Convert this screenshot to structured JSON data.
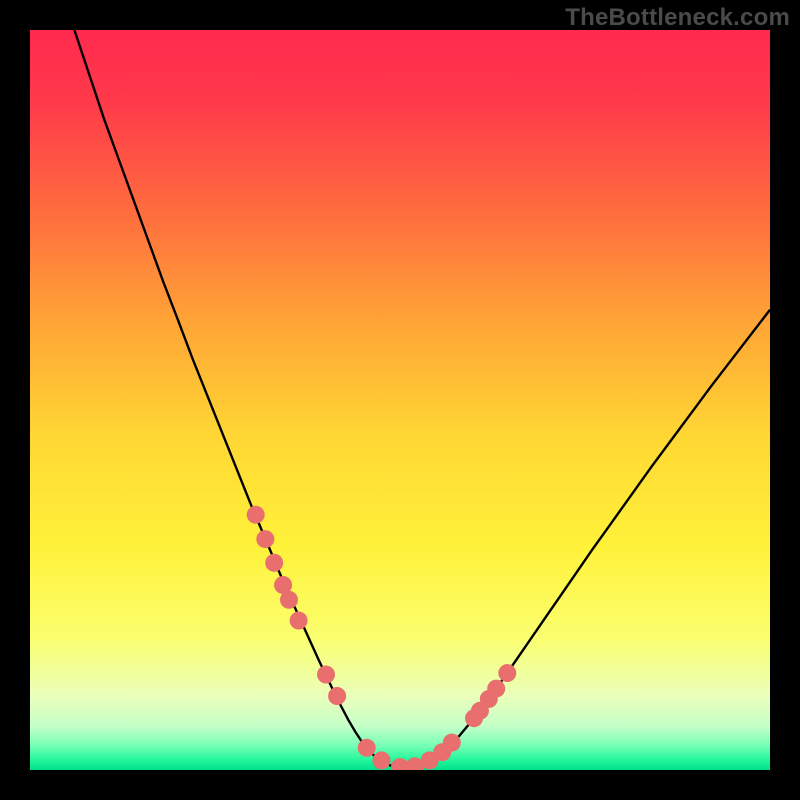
{
  "watermark": "TheBottleneck.com",
  "colors": {
    "background": "#000000",
    "curve": "#000000",
    "marker_fill": "#e96f6f",
    "marker_stroke": "#c95858",
    "gradient_stops": [
      {
        "offset": 0.0,
        "color": "#ff2a4e"
      },
      {
        "offset": 0.1,
        "color": "#ff3a4a"
      },
      {
        "offset": 0.25,
        "color": "#ff6e3e"
      },
      {
        "offset": 0.4,
        "color": "#ffa636"
      },
      {
        "offset": 0.55,
        "color": "#ffd733"
      },
      {
        "offset": 0.7,
        "color": "#fff23a"
      },
      {
        "offset": 0.82,
        "color": "#fbff6e"
      },
      {
        "offset": 0.9,
        "color": "#eaffba"
      },
      {
        "offset": 0.94,
        "color": "#c6ffc8"
      },
      {
        "offset": 0.965,
        "color": "#7dffb8"
      },
      {
        "offset": 0.985,
        "color": "#29f89d"
      },
      {
        "offset": 1.0,
        "color": "#00e08c"
      }
    ]
  },
  "chart_data": {
    "type": "line",
    "title": "",
    "xlabel": "",
    "ylabel": "",
    "xlim": [
      0,
      100
    ],
    "ylim": [
      0,
      100
    ],
    "grid": false,
    "legend": false,
    "series": [
      {
        "name": "bottleneck-curve",
        "x": [
          6,
          8,
          10,
          12,
          14,
          16,
          18,
          20,
          22,
          24,
          26,
          28,
          30,
          32,
          34,
          36,
          37,
          38,
          39,
          40,
          41,
          42,
          43,
          44,
          45,
          46,
          47,
          48,
          49,
          50,
          51,
          52,
          54,
          56,
          58,
          60,
          62,
          64,
          66,
          68,
          70,
          72,
          74,
          76,
          78,
          80,
          82,
          84,
          86,
          88,
          90,
          92,
          94,
          96,
          98,
          100
        ],
        "y": [
          100,
          94,
          88,
          82.5,
          77,
          71.5,
          66,
          60.8,
          55.5,
          50.5,
          45.5,
          40.5,
          35.5,
          30.8,
          26,
          21.5,
          19.3,
          17.1,
          14.9,
          12.8,
          10.7,
          8.7,
          6.8,
          5.1,
          3.6,
          2.4,
          1.5,
          0.9,
          0.5,
          0.3,
          0.3,
          0.5,
          1.2,
          2.6,
          4.6,
          7.0,
          9.6,
          12.4,
          15.3,
          18.2,
          21.1,
          24.0,
          26.9,
          29.8,
          32.6,
          35.4,
          38.2,
          41.0,
          43.7,
          46.4,
          49.1,
          51.8,
          54.4,
          57.0,
          59.6,
          62.2
        ]
      }
    ],
    "markers": {
      "name": "data-points",
      "x": [
        30.5,
        31.8,
        33.0,
        34.2,
        35.0,
        36.3,
        40.0,
        41.5,
        45.5,
        47.5,
        50.0,
        52.0,
        54.0,
        55.7,
        57.0,
        60.0,
        60.8,
        62.0,
        63.0,
        64.5
      ],
      "y": [
        34.5,
        31.2,
        28.0,
        25.0,
        23.0,
        20.2,
        12.9,
        10.0,
        3.0,
        1.3,
        0.4,
        0.5,
        1.3,
        2.4,
        3.7,
        7.0,
        8.0,
        9.6,
        11.0,
        13.1
      ]
    }
  }
}
